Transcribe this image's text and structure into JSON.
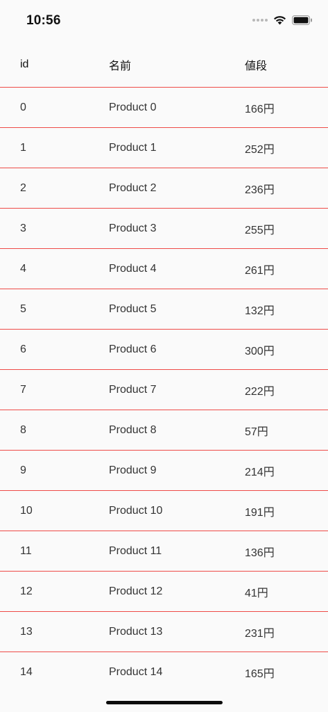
{
  "status_bar": {
    "time": "10:56"
  },
  "table": {
    "headers": {
      "id": "id",
      "name": "名前",
      "price": "値段"
    },
    "rows": [
      {
        "id": "0",
        "name": "Product 0",
        "price": "166円"
      },
      {
        "id": "1",
        "name": "Product 1",
        "price": "252円"
      },
      {
        "id": "2",
        "name": "Product 2",
        "price": "236円"
      },
      {
        "id": "3",
        "name": "Product 3",
        "price": "255円"
      },
      {
        "id": "4",
        "name": "Product 4",
        "price": "261円"
      },
      {
        "id": "5",
        "name": "Product 5",
        "price": "132円"
      },
      {
        "id": "6",
        "name": "Product 6",
        "price": "300円"
      },
      {
        "id": "7",
        "name": "Product 7",
        "price": "222円"
      },
      {
        "id": "8",
        "name": "Product 8",
        "price": "57円"
      },
      {
        "id": "9",
        "name": "Product 9",
        "price": "214円"
      },
      {
        "id": "10",
        "name": "Product 10",
        "price": "191円"
      },
      {
        "id": "11",
        "name": "Product 11",
        "price": "136円"
      },
      {
        "id": "12",
        "name": "Product 12",
        "price": "41円"
      },
      {
        "id": "13",
        "name": "Product 13",
        "price": "231円"
      },
      {
        "id": "14",
        "name": "Product 14",
        "price": "165円"
      }
    ]
  },
  "colors": {
    "divider": "#ee4b47",
    "background": "#fafafa"
  },
  "icons": [
    "cellular-signal-icon",
    "wifi-icon",
    "battery-icon"
  ]
}
